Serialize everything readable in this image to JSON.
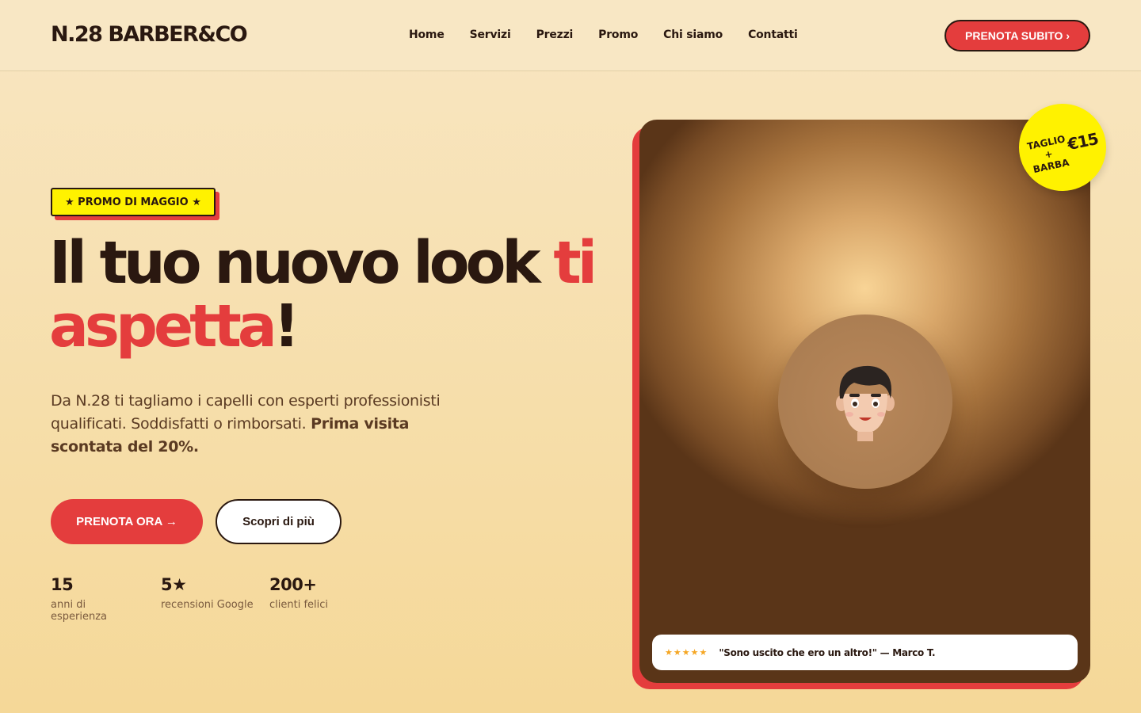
{
  "header": {
    "logo": "N.28 BARBER&CO",
    "nav": [
      "Home",
      "Servizi",
      "Prezzi",
      "Promo",
      "Chi siamo",
      "Contatti"
    ],
    "cta": "PRENOTA SUBITO ›"
  },
  "hero": {
    "promo_tag": "★ PROMO DI MAGGIO ★",
    "title_part1": "Il tuo nuovo look ",
    "title_accent1": "ti",
    "title_accent2": "aspetta",
    "title_end": "!",
    "subtitle_plain": "Da N.28 ti tagliamo i capelli con esperti professionisti qualificati. Soddisfatti o rimborsati. ",
    "subtitle_bold": "Prima visita scontata del 20%.",
    "primary_button": "PRENOTA ORA →",
    "secondary_button": "Scopri di più",
    "stats": [
      {
        "value": "15",
        "label": "anni di esperienza"
      },
      {
        "value": "5★",
        "label": "recensioni Google"
      },
      {
        "value": "200+",
        "label": "clienti felici"
      }
    ]
  },
  "card": {
    "badge_line1": "TAGLIO",
    "badge_line2": "+",
    "badge_line3": "BARBA",
    "badge_price": "€15",
    "review_stars": "★★★★★",
    "review_quote": "\"Sono uscito che ero un altro!\" — Marco T."
  },
  "colors": {
    "accent": "#e43d3d",
    "dark": "#2a1810",
    "highlight": "#fff200",
    "background": "#f8e6c2"
  }
}
